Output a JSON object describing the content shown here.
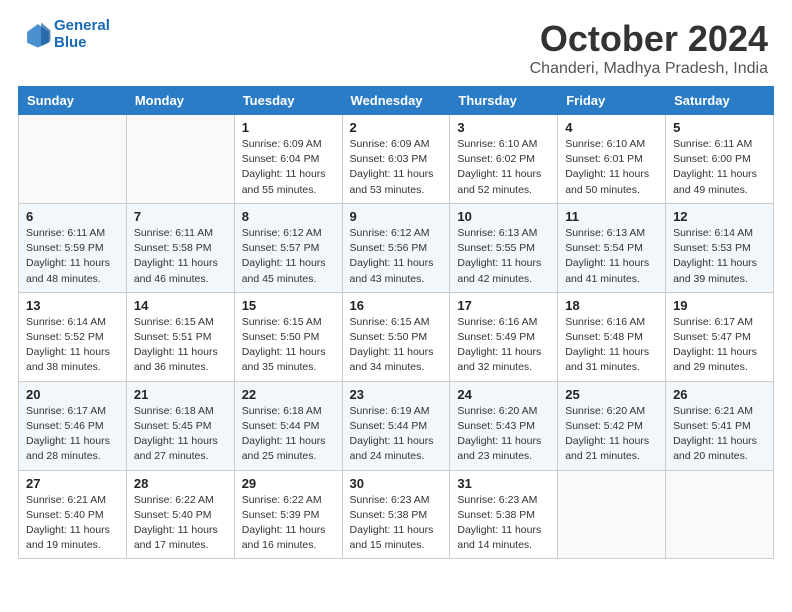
{
  "header": {
    "logo_line1": "General",
    "logo_line2": "Blue",
    "month": "October 2024",
    "location": "Chanderi, Madhya Pradesh, India"
  },
  "weekdays": [
    "Sunday",
    "Monday",
    "Tuesday",
    "Wednesday",
    "Thursday",
    "Friday",
    "Saturday"
  ],
  "weeks": [
    [
      {
        "day": "",
        "sunrise": "",
        "sunset": "",
        "daylight": ""
      },
      {
        "day": "",
        "sunrise": "",
        "sunset": "",
        "daylight": ""
      },
      {
        "day": "1",
        "sunrise": "Sunrise: 6:09 AM",
        "sunset": "Sunset: 6:04 PM",
        "daylight": "Daylight: 11 hours and 55 minutes."
      },
      {
        "day": "2",
        "sunrise": "Sunrise: 6:09 AM",
        "sunset": "Sunset: 6:03 PM",
        "daylight": "Daylight: 11 hours and 53 minutes."
      },
      {
        "day": "3",
        "sunrise": "Sunrise: 6:10 AM",
        "sunset": "Sunset: 6:02 PM",
        "daylight": "Daylight: 11 hours and 52 minutes."
      },
      {
        "day": "4",
        "sunrise": "Sunrise: 6:10 AM",
        "sunset": "Sunset: 6:01 PM",
        "daylight": "Daylight: 11 hours and 50 minutes."
      },
      {
        "day": "5",
        "sunrise": "Sunrise: 6:11 AM",
        "sunset": "Sunset: 6:00 PM",
        "daylight": "Daylight: 11 hours and 49 minutes."
      }
    ],
    [
      {
        "day": "6",
        "sunrise": "Sunrise: 6:11 AM",
        "sunset": "Sunset: 5:59 PM",
        "daylight": "Daylight: 11 hours and 48 minutes."
      },
      {
        "day": "7",
        "sunrise": "Sunrise: 6:11 AM",
        "sunset": "Sunset: 5:58 PM",
        "daylight": "Daylight: 11 hours and 46 minutes."
      },
      {
        "day": "8",
        "sunrise": "Sunrise: 6:12 AM",
        "sunset": "Sunset: 5:57 PM",
        "daylight": "Daylight: 11 hours and 45 minutes."
      },
      {
        "day": "9",
        "sunrise": "Sunrise: 6:12 AM",
        "sunset": "Sunset: 5:56 PM",
        "daylight": "Daylight: 11 hours and 43 minutes."
      },
      {
        "day": "10",
        "sunrise": "Sunrise: 6:13 AM",
        "sunset": "Sunset: 5:55 PM",
        "daylight": "Daylight: 11 hours and 42 minutes."
      },
      {
        "day": "11",
        "sunrise": "Sunrise: 6:13 AM",
        "sunset": "Sunset: 5:54 PM",
        "daylight": "Daylight: 11 hours and 41 minutes."
      },
      {
        "day": "12",
        "sunrise": "Sunrise: 6:14 AM",
        "sunset": "Sunset: 5:53 PM",
        "daylight": "Daylight: 11 hours and 39 minutes."
      }
    ],
    [
      {
        "day": "13",
        "sunrise": "Sunrise: 6:14 AM",
        "sunset": "Sunset: 5:52 PM",
        "daylight": "Daylight: 11 hours and 38 minutes."
      },
      {
        "day": "14",
        "sunrise": "Sunrise: 6:15 AM",
        "sunset": "Sunset: 5:51 PM",
        "daylight": "Daylight: 11 hours and 36 minutes."
      },
      {
        "day": "15",
        "sunrise": "Sunrise: 6:15 AM",
        "sunset": "Sunset: 5:50 PM",
        "daylight": "Daylight: 11 hours and 35 minutes."
      },
      {
        "day": "16",
        "sunrise": "Sunrise: 6:15 AM",
        "sunset": "Sunset: 5:50 PM",
        "daylight": "Daylight: 11 hours and 34 minutes."
      },
      {
        "day": "17",
        "sunrise": "Sunrise: 6:16 AM",
        "sunset": "Sunset: 5:49 PM",
        "daylight": "Daylight: 11 hours and 32 minutes."
      },
      {
        "day": "18",
        "sunrise": "Sunrise: 6:16 AM",
        "sunset": "Sunset: 5:48 PM",
        "daylight": "Daylight: 11 hours and 31 minutes."
      },
      {
        "day": "19",
        "sunrise": "Sunrise: 6:17 AM",
        "sunset": "Sunset: 5:47 PM",
        "daylight": "Daylight: 11 hours and 29 minutes."
      }
    ],
    [
      {
        "day": "20",
        "sunrise": "Sunrise: 6:17 AM",
        "sunset": "Sunset: 5:46 PM",
        "daylight": "Daylight: 11 hours and 28 minutes."
      },
      {
        "day": "21",
        "sunrise": "Sunrise: 6:18 AM",
        "sunset": "Sunset: 5:45 PM",
        "daylight": "Daylight: 11 hours and 27 minutes."
      },
      {
        "day": "22",
        "sunrise": "Sunrise: 6:18 AM",
        "sunset": "Sunset: 5:44 PM",
        "daylight": "Daylight: 11 hours and 25 minutes."
      },
      {
        "day": "23",
        "sunrise": "Sunrise: 6:19 AM",
        "sunset": "Sunset: 5:44 PM",
        "daylight": "Daylight: 11 hours and 24 minutes."
      },
      {
        "day": "24",
        "sunrise": "Sunrise: 6:20 AM",
        "sunset": "Sunset: 5:43 PM",
        "daylight": "Daylight: 11 hours and 23 minutes."
      },
      {
        "day": "25",
        "sunrise": "Sunrise: 6:20 AM",
        "sunset": "Sunset: 5:42 PM",
        "daylight": "Daylight: 11 hours and 21 minutes."
      },
      {
        "day": "26",
        "sunrise": "Sunrise: 6:21 AM",
        "sunset": "Sunset: 5:41 PM",
        "daylight": "Daylight: 11 hours and 20 minutes."
      }
    ],
    [
      {
        "day": "27",
        "sunrise": "Sunrise: 6:21 AM",
        "sunset": "Sunset: 5:40 PM",
        "daylight": "Daylight: 11 hours and 19 minutes."
      },
      {
        "day": "28",
        "sunrise": "Sunrise: 6:22 AM",
        "sunset": "Sunset: 5:40 PM",
        "daylight": "Daylight: 11 hours and 17 minutes."
      },
      {
        "day": "29",
        "sunrise": "Sunrise: 6:22 AM",
        "sunset": "Sunset: 5:39 PM",
        "daylight": "Daylight: 11 hours and 16 minutes."
      },
      {
        "day": "30",
        "sunrise": "Sunrise: 6:23 AM",
        "sunset": "Sunset: 5:38 PM",
        "daylight": "Daylight: 11 hours and 15 minutes."
      },
      {
        "day": "31",
        "sunrise": "Sunrise: 6:23 AM",
        "sunset": "Sunset: 5:38 PM",
        "daylight": "Daylight: 11 hours and 14 minutes."
      },
      {
        "day": "",
        "sunrise": "",
        "sunset": "",
        "daylight": ""
      },
      {
        "day": "",
        "sunrise": "",
        "sunset": "",
        "daylight": ""
      }
    ]
  ]
}
